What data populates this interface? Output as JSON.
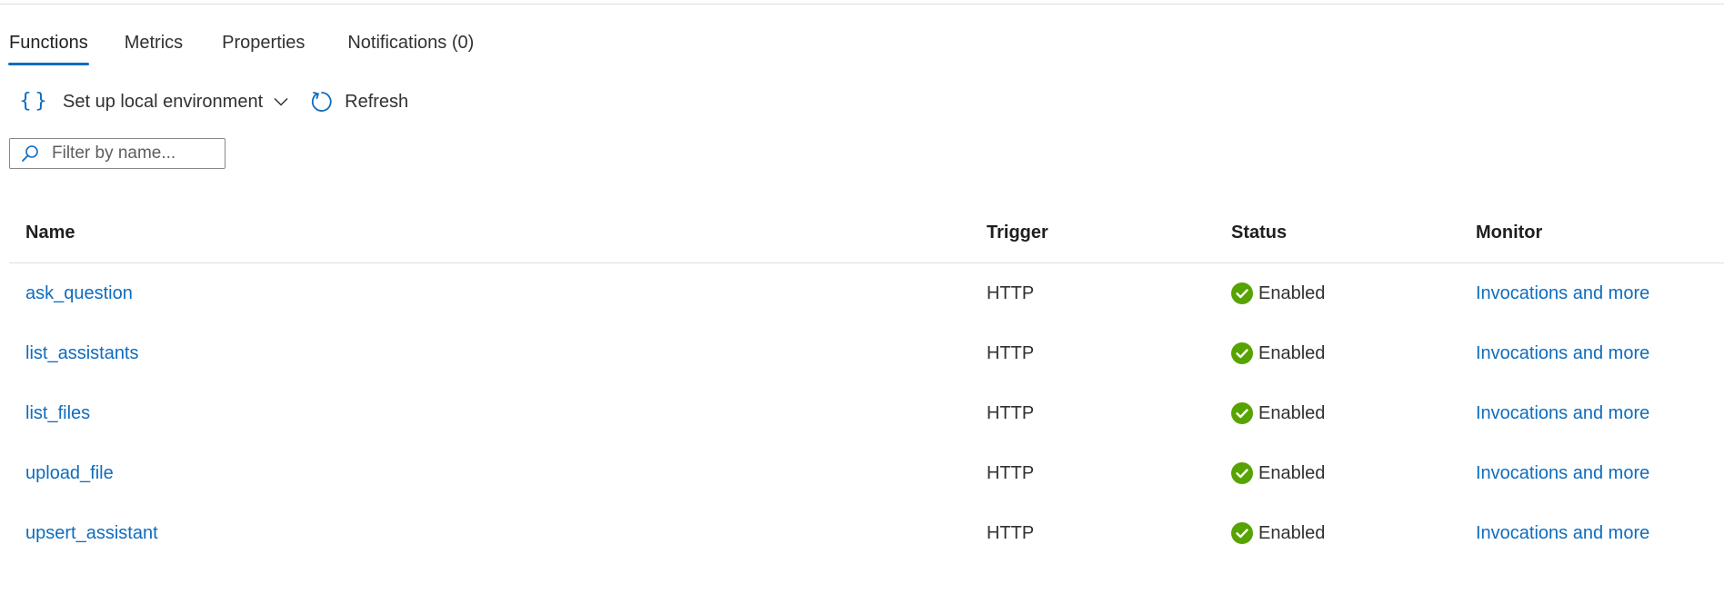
{
  "tabs": [
    {
      "label": "Functions",
      "active": true
    },
    {
      "label": "Metrics",
      "active": false
    },
    {
      "label": "Properties",
      "active": false
    },
    {
      "label": "Notifications (0)",
      "active": false
    }
  ],
  "toolbar": {
    "setup_label": "Set up local environment",
    "setup_icon": "braces-icon",
    "refresh_label": "Refresh",
    "refresh_icon": "refresh-icon"
  },
  "filter": {
    "placeholder": "Filter by name...",
    "value": ""
  },
  "table": {
    "columns": [
      "Name",
      "Trigger",
      "Status",
      "Monitor"
    ],
    "rows": [
      {
        "name": "ask_question",
        "trigger": "HTTP",
        "status": "Enabled",
        "monitor": "Invocations and more"
      },
      {
        "name": "list_assistants",
        "trigger": "HTTP",
        "status": "Enabled",
        "monitor": "Invocations and more"
      },
      {
        "name": "list_files",
        "trigger": "HTTP",
        "status": "Enabled",
        "monitor": "Invocations and more"
      },
      {
        "name": "upload_file",
        "trigger": "HTTP",
        "status": "Enabled",
        "monitor": "Invocations and more"
      },
      {
        "name": "upsert_assistant",
        "trigger": "HTTP",
        "status": "Enabled",
        "monitor": "Invocations and more"
      }
    ]
  },
  "colors": {
    "accent": "#0f6cbd",
    "status_ok": "#57a300",
    "text": "#323130"
  }
}
